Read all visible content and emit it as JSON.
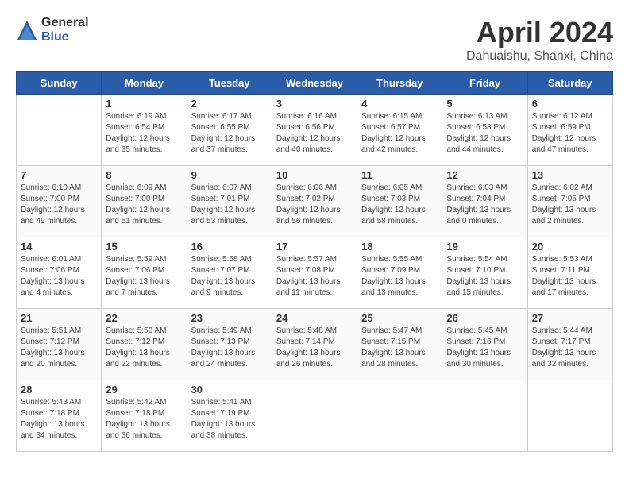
{
  "header": {
    "logo_general": "General",
    "logo_blue": "Blue",
    "title": "April 2024",
    "subtitle": "Dahuaishu, Shanxi, China"
  },
  "days_of_week": [
    "Sunday",
    "Monday",
    "Tuesday",
    "Wednesday",
    "Thursday",
    "Friday",
    "Saturday"
  ],
  "weeks": [
    [
      {
        "num": "",
        "empty": true
      },
      {
        "num": "1",
        "sunrise": "6:19 AM",
        "sunset": "6:54 PM",
        "daylight": "12 hours and 35 minutes."
      },
      {
        "num": "2",
        "sunrise": "6:17 AM",
        "sunset": "6:55 PM",
        "daylight": "12 hours and 37 minutes."
      },
      {
        "num": "3",
        "sunrise": "6:16 AM",
        "sunset": "6:56 PM",
        "daylight": "12 hours and 40 minutes."
      },
      {
        "num": "4",
        "sunrise": "6:15 AM",
        "sunset": "6:57 PM",
        "daylight": "12 hours and 42 minutes."
      },
      {
        "num": "5",
        "sunrise": "6:13 AM",
        "sunset": "6:58 PM",
        "daylight": "12 hours and 44 minutes."
      },
      {
        "num": "6",
        "sunrise": "6:12 AM",
        "sunset": "6:59 PM",
        "daylight": "12 hours and 47 minutes."
      }
    ],
    [
      {
        "num": "7",
        "sunrise": "6:10 AM",
        "sunset": "7:00 PM",
        "daylight": "12 hours and 49 minutes."
      },
      {
        "num": "8",
        "sunrise": "6:09 AM",
        "sunset": "7:00 PM",
        "daylight": "12 hours and 51 minutes."
      },
      {
        "num": "9",
        "sunrise": "6:07 AM",
        "sunset": "7:01 PM",
        "daylight": "12 hours and 53 minutes."
      },
      {
        "num": "10",
        "sunrise": "6:06 AM",
        "sunset": "7:02 PM",
        "daylight": "12 hours and 56 minutes."
      },
      {
        "num": "11",
        "sunrise": "6:05 AM",
        "sunset": "7:03 PM",
        "daylight": "12 hours and 58 minutes."
      },
      {
        "num": "12",
        "sunrise": "6:03 AM",
        "sunset": "7:04 PM",
        "daylight": "13 hours and 0 minutes."
      },
      {
        "num": "13",
        "sunrise": "6:02 AM",
        "sunset": "7:05 PM",
        "daylight": "13 hours and 2 minutes."
      }
    ],
    [
      {
        "num": "14",
        "sunrise": "6:01 AM",
        "sunset": "7:06 PM",
        "daylight": "13 hours and 4 minutes."
      },
      {
        "num": "15",
        "sunrise": "5:59 AM",
        "sunset": "7:06 PM",
        "daylight": "13 hours and 7 minutes."
      },
      {
        "num": "16",
        "sunrise": "5:58 AM",
        "sunset": "7:07 PM",
        "daylight": "13 hours and 9 minutes."
      },
      {
        "num": "17",
        "sunrise": "5:57 AM",
        "sunset": "7:08 PM",
        "daylight": "13 hours and 11 minutes."
      },
      {
        "num": "18",
        "sunrise": "5:55 AM",
        "sunset": "7:09 PM",
        "daylight": "13 hours and 13 minutes."
      },
      {
        "num": "19",
        "sunrise": "5:54 AM",
        "sunset": "7:10 PM",
        "daylight": "13 hours and 15 minutes."
      },
      {
        "num": "20",
        "sunrise": "5:53 AM",
        "sunset": "7:11 PM",
        "daylight": "13 hours and 17 minutes."
      }
    ],
    [
      {
        "num": "21",
        "sunrise": "5:51 AM",
        "sunset": "7:12 PM",
        "daylight": "13 hours and 20 minutes."
      },
      {
        "num": "22",
        "sunrise": "5:50 AM",
        "sunset": "7:12 PM",
        "daylight": "13 hours and 22 minutes."
      },
      {
        "num": "23",
        "sunrise": "5:49 AM",
        "sunset": "7:13 PM",
        "daylight": "13 hours and 24 minutes."
      },
      {
        "num": "24",
        "sunrise": "5:48 AM",
        "sunset": "7:14 PM",
        "daylight": "13 hours and 26 minutes."
      },
      {
        "num": "25",
        "sunrise": "5:47 AM",
        "sunset": "7:15 PM",
        "daylight": "13 hours and 28 minutes."
      },
      {
        "num": "26",
        "sunrise": "5:45 AM",
        "sunset": "7:16 PM",
        "daylight": "13 hours and 30 minutes."
      },
      {
        "num": "27",
        "sunrise": "5:44 AM",
        "sunset": "7:17 PM",
        "daylight": "13 hours and 32 minutes."
      }
    ],
    [
      {
        "num": "28",
        "sunrise": "5:43 AM",
        "sunset": "7:18 PM",
        "daylight": "13 hours and 34 minutes."
      },
      {
        "num": "29",
        "sunrise": "5:42 AM",
        "sunset": "7:18 PM",
        "daylight": "13 hours and 36 minutes."
      },
      {
        "num": "30",
        "sunrise": "5:41 AM",
        "sunset": "7:19 PM",
        "daylight": "13 hours and 38 minutes."
      },
      {
        "num": "",
        "empty": true
      },
      {
        "num": "",
        "empty": true
      },
      {
        "num": "",
        "empty": true
      },
      {
        "num": "",
        "empty": true
      }
    ]
  ]
}
